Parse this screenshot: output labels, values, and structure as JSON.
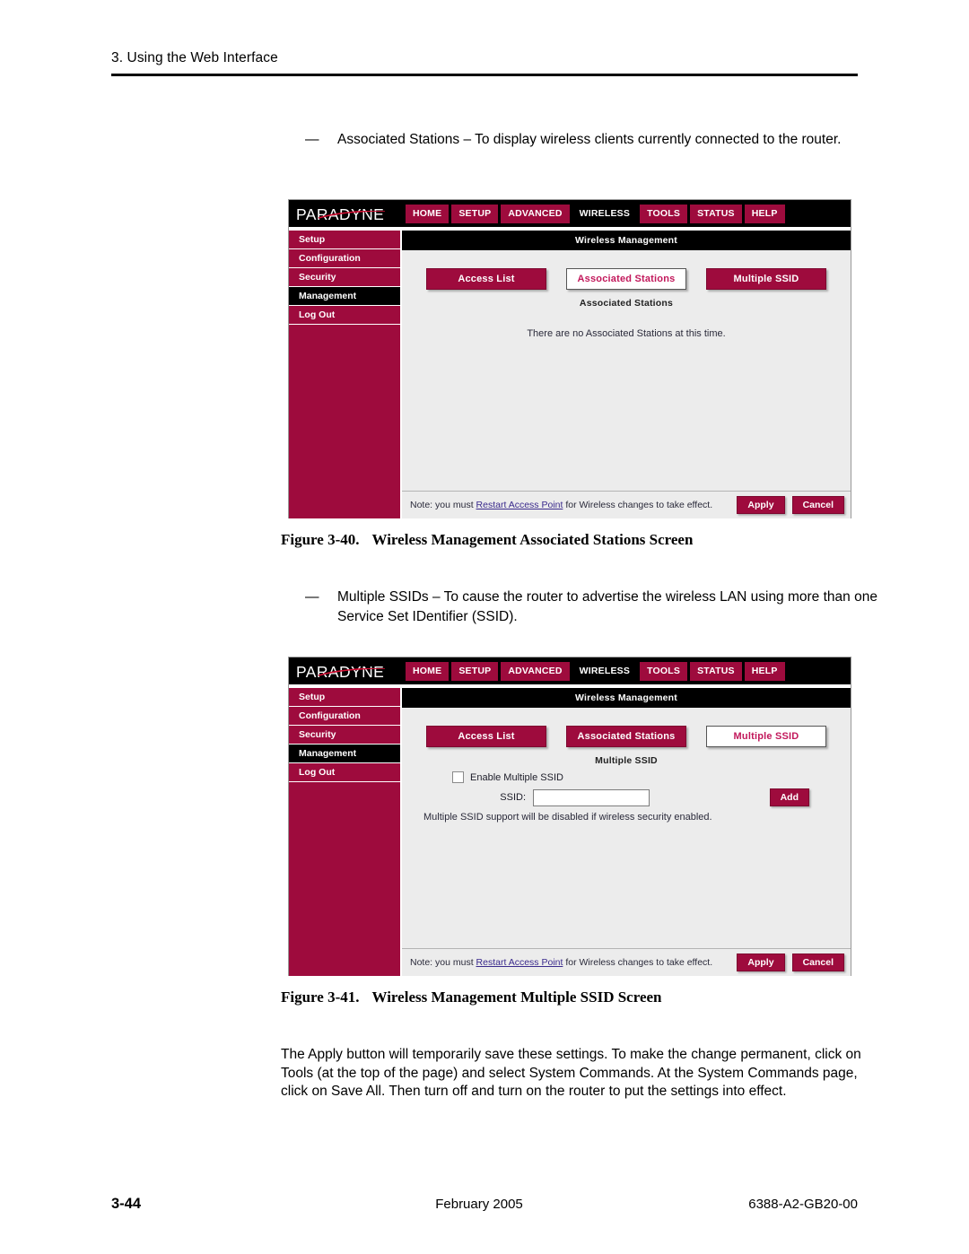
{
  "page": {
    "running_header": "3. Using the Web Interface",
    "footer": {
      "page_number": "3-44",
      "date": "February 2005",
      "doc_id": "6388-A2-GB20-00"
    }
  },
  "bullets": [
    {
      "dash": "—",
      "text": "Associated Stations – To display wireless clients currently connected to the router."
    },
    {
      "dash": "—",
      "text": "Multiple SSIDs – To cause the router to advertise the wireless LAN using more than one Service Set IDentifier (SSID)."
    }
  ],
  "captions": [
    {
      "number": "Figure 3-40.",
      "title": "Wireless Management Associated Stations Screen"
    },
    {
      "number": "Figure 3-41.",
      "title": "Wireless Management Multiple SSID Screen"
    }
  ],
  "closing_paragraph": "The Apply button will temporarily save these settings. To make the change permanent, click on Tools (at the top of the page) and select System Commands. At the System Commands page, click on Save All. Then turn off and turn on the router to put the settings into effect.",
  "colors": {
    "brand_maroon": "#9e0b3d",
    "active_black": "#000000",
    "content_gray": "#ececec",
    "tab_active_text": "#c2185b",
    "link_blue": "#3a2a8c"
  },
  "router_ui": {
    "logo": "PARADYNE",
    "nav": [
      {
        "label": "HOME",
        "active": false
      },
      {
        "label": "SETUP",
        "active": false
      },
      {
        "label": "ADVANCED",
        "active": false
      },
      {
        "label": "WIRELESS",
        "active": true
      },
      {
        "label": "TOOLS",
        "active": false
      },
      {
        "label": "STATUS",
        "active": false
      },
      {
        "label": "HELP",
        "active": false
      }
    ],
    "sidebar": [
      {
        "label": "Setup",
        "active": false
      },
      {
        "label": "Configuration",
        "active": false
      },
      {
        "label": "Security",
        "active": false
      },
      {
        "label": "Management",
        "active": true
      },
      {
        "label": "Log Out",
        "active": false
      }
    ],
    "title_bar": "Wireless Management",
    "tabs": [
      {
        "label": "Access List"
      },
      {
        "label": "Associated Stations"
      },
      {
        "label": "Multiple SSID"
      }
    ],
    "note_bar": {
      "prefix": "Note: you must ",
      "link": "Restart Access Point",
      "suffix": " for Wireless changes to take effect.",
      "apply_label": "Apply",
      "cancel_label": "Cancel"
    }
  },
  "screen_associated_stations": {
    "active_tab_index": 1,
    "subtitle": "Associated Stations",
    "message": "There are no Associated Stations at this time."
  },
  "screen_multiple_ssid": {
    "active_tab_index": 2,
    "subtitle": "Multiple SSID",
    "enable_checkbox_label": "Enable Multiple SSID",
    "enable_checked": false,
    "ssid_label": "SSID:",
    "ssid_value": "",
    "ssid_placeholder": "",
    "add_label": "Add",
    "hint": "Multiple SSID support will be disabled if wireless security enabled."
  }
}
